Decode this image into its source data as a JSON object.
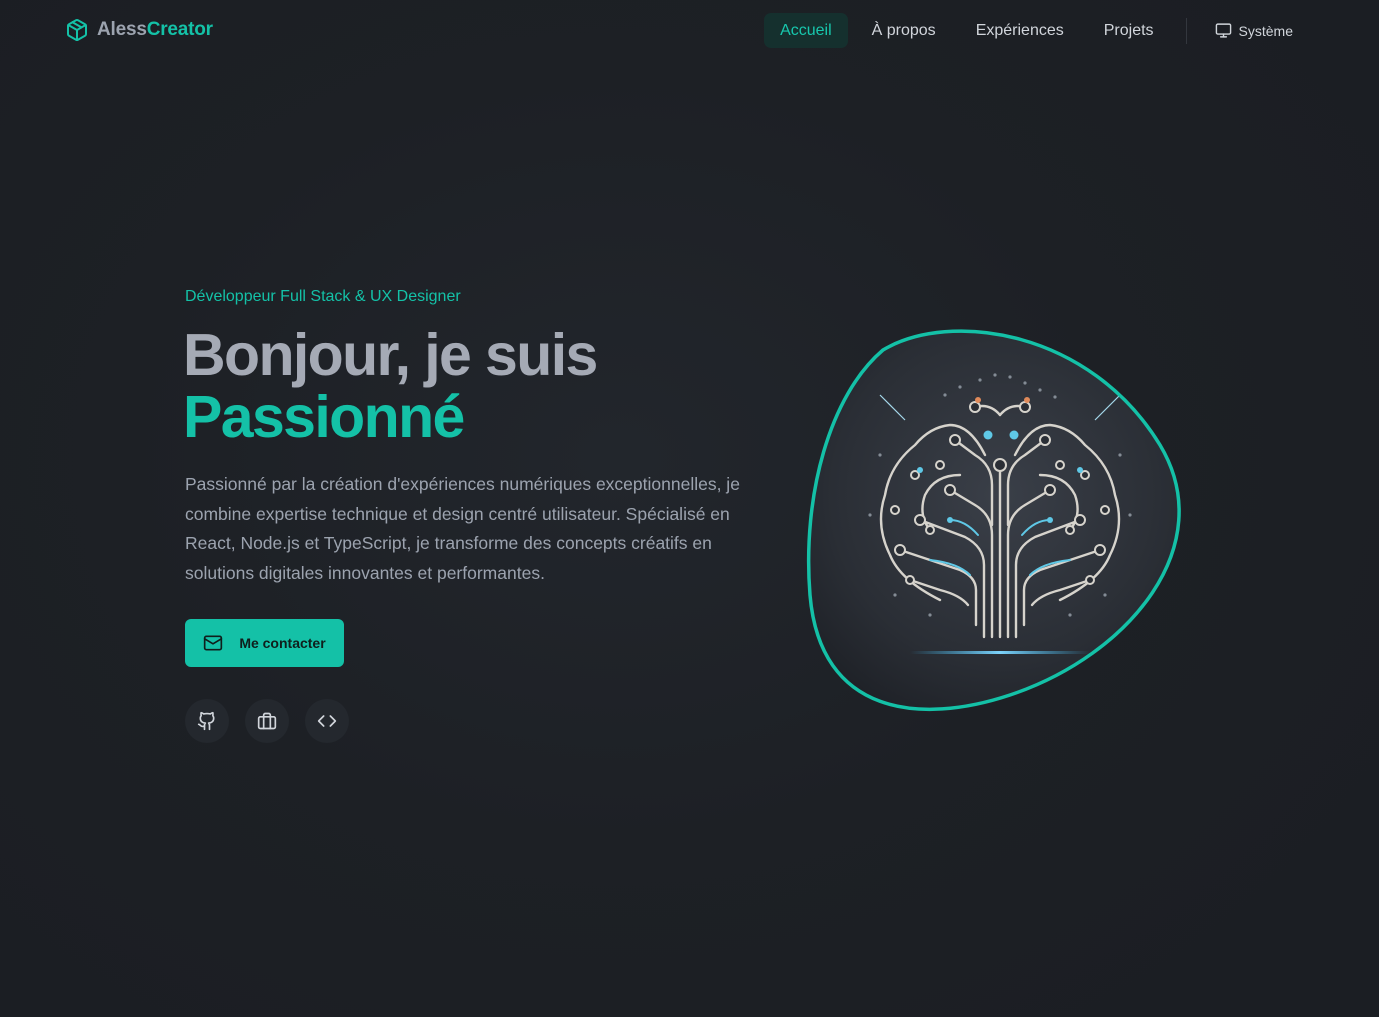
{
  "brand": {
    "name_part1": "Aless",
    "name_part2": "Creator",
    "icon": "cube-icon"
  },
  "nav": {
    "items": [
      {
        "label": "Accueil",
        "active": true
      },
      {
        "label": "À propos",
        "active": false
      },
      {
        "label": "Expériences",
        "active": false
      },
      {
        "label": "Projets",
        "active": false
      }
    ],
    "theme": {
      "label": "Système",
      "icon": "monitor-icon"
    }
  },
  "hero": {
    "subtitle": "Développeur Full Stack & UX Designer",
    "title_line1": "Bonjour, je suis",
    "title_line2": "Passionné",
    "description": "Passionné par la création d'expériences numériques exceptionnelles, je combine expertise technique et design centré utilisateur. Spécialisé en React, Node.js et TypeScript, je transforme des concepts créatifs en solutions digitales innovantes et performantes.",
    "cta_label": "Me contacter",
    "cta_icon": "mail-icon",
    "socials": [
      {
        "icon": "github-icon"
      },
      {
        "icon": "briefcase-icon"
      },
      {
        "icon": "code-icon"
      }
    ],
    "image": "circuit-brain-illustration"
  },
  "colors": {
    "accent": "#14c1a7",
    "background": "#1d2025",
    "text_muted": "#9ca3af"
  }
}
